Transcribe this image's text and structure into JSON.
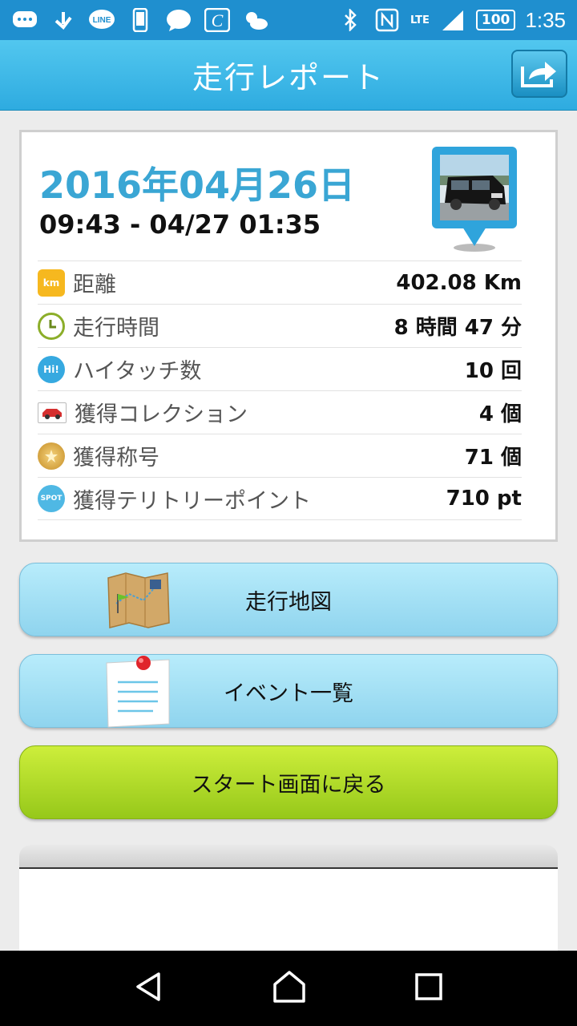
{
  "status_bar": {
    "icons": [
      "chat-icon",
      "download-icon",
      "line-icon",
      "phone-icon",
      "message-icon",
      "app-c-icon",
      "weather-icon"
    ],
    "line_text": "LINE",
    "network": "LTE",
    "battery": "100",
    "time": "1:35"
  },
  "header": {
    "title": "走行レポート"
  },
  "report": {
    "date": "2016年04月26日",
    "time_range": "09:43 - 04/27 01:35",
    "rows": [
      {
        "icon": "km-icon",
        "icon_text": "km",
        "label": "距離",
        "value": "402.08 Km"
      },
      {
        "icon": "clock-icon",
        "icon_text": "",
        "label": "走行時間",
        "value": "8 時間 47 分"
      },
      {
        "icon": "hi-touch-icon",
        "icon_text": "Hi!",
        "label": "ハイタッチ数",
        "value": "10 回"
      },
      {
        "icon": "car-collection-icon",
        "icon_text": "",
        "label": "獲得コレクション",
        "value": "4 個"
      },
      {
        "icon": "medal-icon",
        "icon_text": "",
        "label": "獲得称号",
        "value": "71 個"
      },
      {
        "icon": "spot-icon",
        "icon_text": "SPOT",
        "label": "獲得テリトリーポイント",
        "value": "710 pt"
      }
    ]
  },
  "buttons": {
    "map": "走行地図",
    "events": "イベント一覧",
    "back_to_start": "スタート画面に戻る"
  },
  "colors": {
    "header": "#2eabe0",
    "date": "#3aa6d4",
    "blue_button": "#8fd4ee",
    "green_button": "#a6d21e"
  }
}
